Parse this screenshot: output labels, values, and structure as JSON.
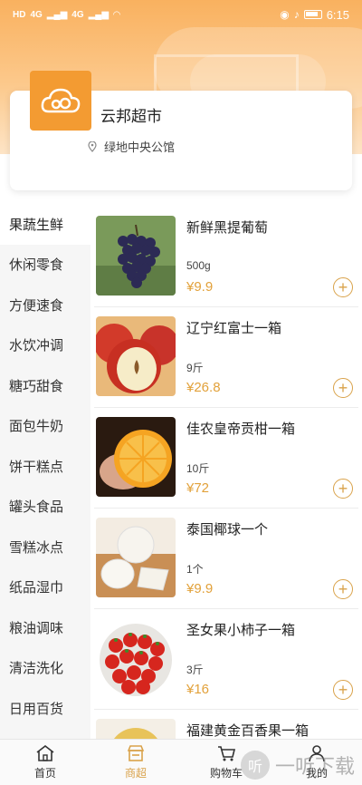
{
  "status": {
    "network": "HD",
    "signal1": "4G",
    "signal2": "4G",
    "time": "6:15"
  },
  "store": {
    "name": "云邦超市",
    "location": "绿地中央公馆"
  },
  "categories": [
    {
      "label": "果蔬生鲜",
      "active": true
    },
    {
      "label": "休闲零食"
    },
    {
      "label": "方便速食"
    },
    {
      "label": "水饮冲调"
    },
    {
      "label": "糖巧甜食"
    },
    {
      "label": "面包牛奶"
    },
    {
      "label": "饼干糕点"
    },
    {
      "label": "罐头食品"
    },
    {
      "label": "雪糕冰点"
    },
    {
      "label": "纸品湿巾"
    },
    {
      "label": "粮油调味"
    },
    {
      "label": "清洁洗化"
    },
    {
      "label": "日用百货"
    }
  ],
  "products": [
    {
      "name": "新鲜黑提葡萄",
      "spec": "500g",
      "price": "¥9.9",
      "image": "grapes"
    },
    {
      "name": "辽宁红富士一箱",
      "spec": "9斤",
      "price": "¥26.8",
      "image": "apples"
    },
    {
      "name": "佳农皇帝贡柑一箱",
      "spec": "10斤",
      "price": "¥72",
      "image": "orange"
    },
    {
      "name": "泰国椰球一个",
      "spec": "1个",
      "price": "¥9.9",
      "image": "coconut"
    },
    {
      "name": "圣女果小柿子一箱",
      "spec": "3斤",
      "price": "¥16",
      "image": "tomatoes"
    },
    {
      "name": "福建黄金百香果一箱",
      "spec": "",
      "price": "",
      "image": "passionfruit"
    }
  ],
  "tabs": [
    {
      "label": "首页",
      "icon": "home-icon"
    },
    {
      "label": "商超",
      "icon": "store-icon",
      "active": true
    },
    {
      "label": "购物车",
      "icon": "cart-icon"
    },
    {
      "label": "我的",
      "icon": "user-icon"
    }
  ],
  "watermark": {
    "glyph": "听",
    "text": "一听下载"
  },
  "colors": {
    "accent": "#d9a24a",
    "header": "#f9b15f",
    "logo": "#f39b32"
  }
}
